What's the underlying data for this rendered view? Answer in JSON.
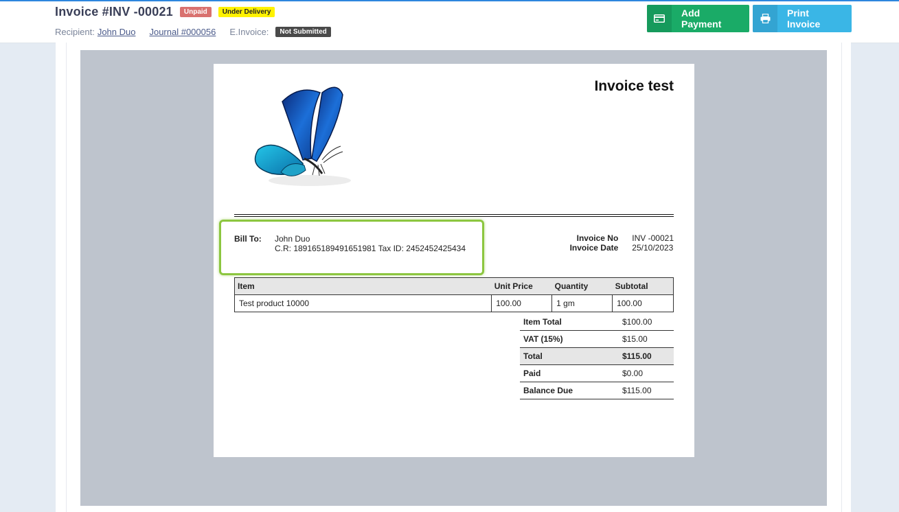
{
  "header": {
    "title": "Invoice #INV -00021",
    "badges": {
      "unpaid": "Unpaid",
      "delivery": "Under Delivery"
    },
    "recipient_label": "Recipient:",
    "recipient_name": "John Duo",
    "journal_link": "Journal #000056",
    "einvoice_label": "E.Invoice:",
    "einvoice_status": "Not Submitted",
    "add_payment_label": "Add Payment",
    "print_invoice_label": "Print Invoice"
  },
  "invoice": {
    "heading": "Invoice test",
    "bill_to_label": "Bill To:",
    "bill_to_name": "John Duo",
    "bill_to_ids": "C.R: 189165189491651981 Tax ID: 2452452425434",
    "invoice_no_label": "Invoice No",
    "invoice_no": "INV -00021",
    "invoice_date_label": "Invoice Date",
    "invoice_date": "25/10/2023",
    "columns": [
      "Item",
      "Unit Price",
      "Quantity",
      "Subtotal"
    ],
    "rows": [
      {
        "item": "Test product 10000",
        "unit_price": "100.00",
        "quantity": "1 gm",
        "subtotal": "100.00"
      }
    ],
    "totals": [
      {
        "label": "Item Total",
        "value": "$100.00"
      },
      {
        "label": "VAT (15%)",
        "value": "$15.00"
      },
      {
        "label": "Total",
        "value": "$115.00"
      },
      {
        "label": "Paid",
        "value": "$0.00"
      },
      {
        "label": "Balance Due",
        "value": "$115.00"
      }
    ]
  },
  "colors": {
    "add_payment": "#1aab67",
    "print_invoice": "#3ab6e6",
    "highlight_box": "#8cc63f",
    "unpaid_badge": "#d9716f",
    "delivery_badge": "#fff200"
  },
  "icons": {
    "add_payment": "credit-card-icon",
    "print_invoice": "printer-icon",
    "logo": "butterfly-logo"
  }
}
